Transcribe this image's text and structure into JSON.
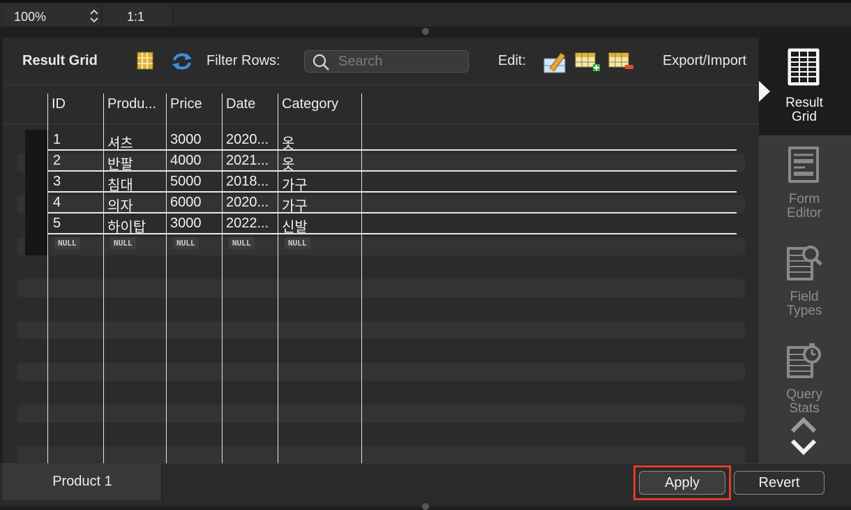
{
  "topbar": {
    "zoom": "100%",
    "ratio": "1:1"
  },
  "toolbar": {
    "title": "Result Grid",
    "filter_label": "Filter Rows:",
    "search_placeholder": "Search",
    "search_value": "",
    "edit_label": "Edit:",
    "export_label": "Export/Import"
  },
  "grid": {
    "columns": [
      "ID",
      "Produ...",
      "Price",
      "Date",
      "Category"
    ],
    "rows": [
      [
        "1",
        "셔츠",
        "3000",
        "2020...",
        "옷"
      ],
      [
        "2",
        "반팔",
        "4000",
        "2021...",
        "옷"
      ],
      [
        "3",
        "침대",
        "5000",
        "2018...",
        "가구"
      ],
      [
        "4",
        "의자",
        "6000",
        "2020...",
        "가구"
      ],
      [
        "5",
        "하이탑",
        "3000",
        "2022...",
        "신발"
      ]
    ],
    "null_label": "NULL"
  },
  "sidebar": {
    "tabs": [
      {
        "label": "Result\nGrid",
        "icon": "result-grid-icon",
        "active": true
      },
      {
        "label": "Form\nEditor",
        "icon": "form-editor-icon",
        "active": false
      },
      {
        "label": "Field\nTypes",
        "icon": "field-types-icon",
        "active": false
      },
      {
        "label": "Query\nStats",
        "icon": "query-stats-icon",
        "active": false
      }
    ]
  },
  "footer": {
    "result_tab": "Product 1",
    "apply_label": "Apply",
    "revert_label": "Revert"
  },
  "colors": {
    "highlight": "#e23a2c",
    "background": "#2b2b2b",
    "active_tab": "#1c1c1c"
  }
}
